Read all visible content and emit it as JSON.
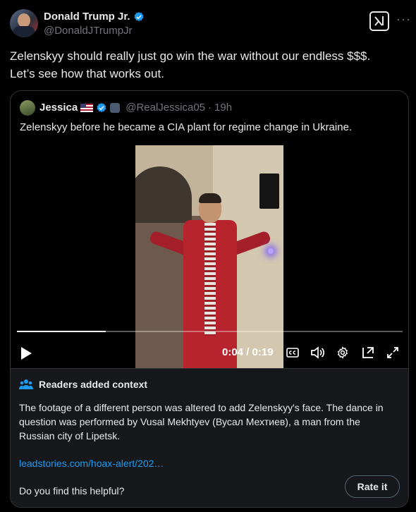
{
  "post": {
    "author_name": "Donald Trump Jr.",
    "author_handle": "@DonaldJTrumpJr",
    "text_line1": "Zelenskyy should really just go win the war without our endless $$$.",
    "text_line2": "Let’s see how that works out.",
    "more_icon": "more-dots",
    "grok_icon": "grok-icon"
  },
  "quoted": {
    "author_name": "Jessica",
    "author_handle": "@RealJessica05",
    "separator": "·",
    "time_ago": "19h",
    "text": "Zelenskyy before he became a CIA plant for regime change in Ukraine.",
    "video": {
      "current_time": "0:04",
      "separator": "/",
      "duration": "0:19",
      "progress_fraction": 0.23
    }
  },
  "context_note": {
    "title": "Readers added context",
    "body": "The footage of a different person was altered to add Zelenskyy's face. The dance in question was performed by Vusal Mekhtyev (Вусал Мехтиев), a man from the Russian city of Lipetsk.",
    "link": "leadstories.com/hoax-alert/202…",
    "helpful_prompt": "Do you find this helpful?",
    "rate_button": "Rate it"
  },
  "colors": {
    "background": "#000000",
    "text": "#e7e9ea",
    "muted": "#71767b",
    "link": "#1d9bf0",
    "verified": "#1d9bf0",
    "context_bg": "#16181c"
  }
}
